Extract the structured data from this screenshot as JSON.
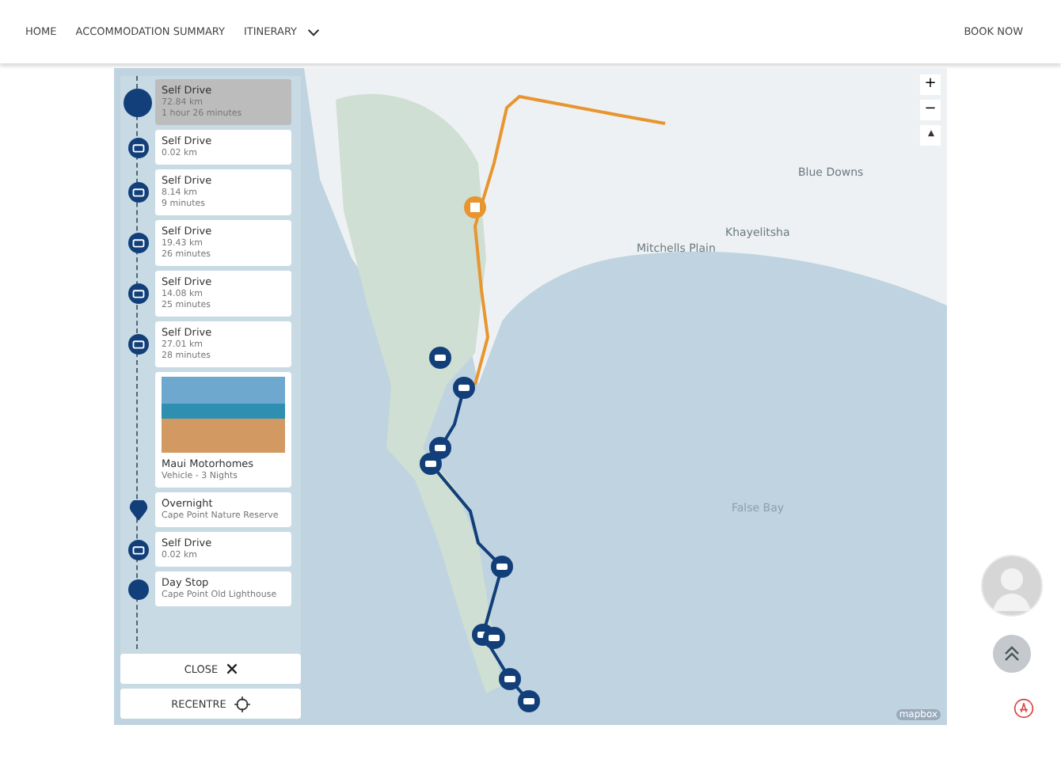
{
  "nav": {
    "items": [
      {
        "label": "HOME",
        "dropdown": false
      },
      {
        "label": "ACCOMMODATION SUMMARY",
        "dropdown": false
      },
      {
        "label": "ITINERARY",
        "dropdown": true
      }
    ],
    "action": "BOOK NOW"
  },
  "itinerary": {
    "stops": [
      {
        "kind": "drive",
        "title": "Self Drive",
        "lines": [
          "72.84 km",
          "1 hour 26 minutes"
        ],
        "selected": true
      },
      {
        "kind": "drive",
        "title": "Self Drive",
        "lines": [
          "0.02 km"
        ],
        "selected": false
      },
      {
        "kind": "drive",
        "title": "Self Drive",
        "lines": [
          "8.14 km",
          "9 minutes"
        ],
        "selected": false
      },
      {
        "kind": "drive",
        "title": "Self Drive",
        "lines": [
          "19.43 km",
          "26 minutes"
        ],
        "selected": false
      },
      {
        "kind": "drive",
        "title": "Self Drive",
        "lines": [
          "14.08 km",
          "25 minutes"
        ],
        "selected": false
      },
      {
        "kind": "drive",
        "title": "Self Drive",
        "lines": [
          "27.01 km",
          "28 minutes"
        ],
        "selected": false
      },
      {
        "kind": "vehicle",
        "title": "Maui Motorhomes",
        "lines": [
          "Vehicle - 3 Nights"
        ],
        "selected": false
      },
      {
        "kind": "overnight",
        "title": "Overnight",
        "lines": [
          "Cape Point Nature Reserve"
        ],
        "selected": false
      },
      {
        "kind": "drive",
        "title": "Self Drive",
        "lines": [
          "0.02 km"
        ],
        "selected": false
      },
      {
        "kind": "daystop",
        "title": "Day Stop",
        "lines": [
          "Cape Point Old Lighthouse"
        ],
        "selected": false
      }
    ],
    "close": "CLOSE",
    "recentre": "RECENTRE"
  },
  "map": {
    "zoom_in": "+",
    "zoom_out": "−",
    "labels": [
      {
        "text": "Blue Downs",
        "kind": "place"
      },
      {
        "text": "Khayelitsha",
        "kind": "place"
      },
      {
        "text": "Mitchells Plain",
        "kind": "place"
      },
      {
        "text": "False Bay",
        "kind": "water"
      }
    ],
    "attribution": "mapbox"
  }
}
